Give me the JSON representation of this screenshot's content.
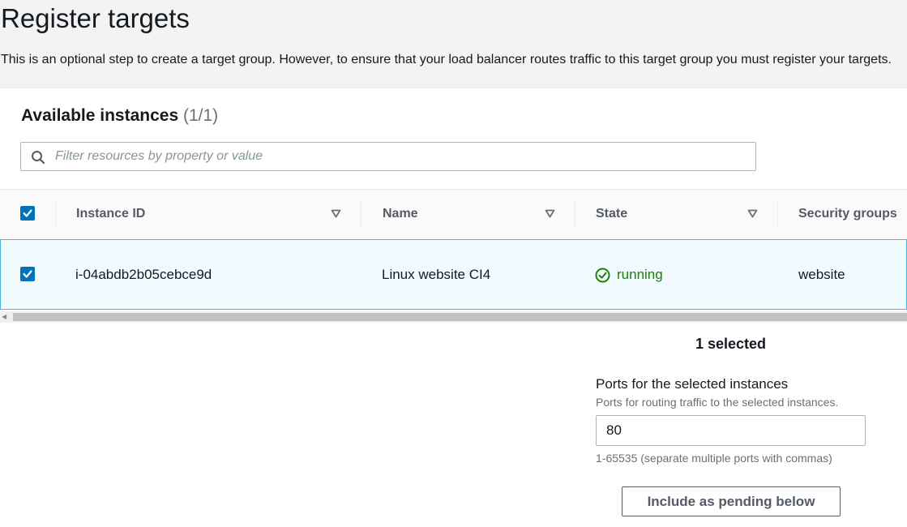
{
  "page": {
    "title": "Register targets",
    "description": "This is an optional step to create a target group. However, to ensure that your load balancer routes traffic to this target group you must register your targets."
  },
  "instances": {
    "heading": "Available instances",
    "count": "(1/1)",
    "filter_placeholder": "Filter resources by property or value",
    "columns": [
      {
        "label": "Instance ID",
        "sortable": true
      },
      {
        "label": "Name",
        "sortable": true
      },
      {
        "label": "State",
        "sortable": true
      },
      {
        "label": "Security groups",
        "sortable": false
      }
    ],
    "select_all_checked": true,
    "rows": [
      {
        "selected": true,
        "instance_id": "i-04abdb2b05cebce9d",
        "name": "Linux website CI4",
        "state": "running",
        "state_icon": "check-circle-icon",
        "security_groups": "website"
      }
    ]
  },
  "selection": {
    "summary": "1 selected",
    "ports_label": "Ports for the selected instances",
    "ports_description": "Ports for routing traffic to the selected instances.",
    "ports_value": "80",
    "ports_hint": "1-65535 (separate multiple ports with commas)",
    "include_button_label": "Include as pending below"
  },
  "colors": {
    "accent": "#0073bb",
    "running": "#1d8102",
    "selected_row_bg": "#f1faff",
    "selected_row_border": "#44b9d6"
  }
}
